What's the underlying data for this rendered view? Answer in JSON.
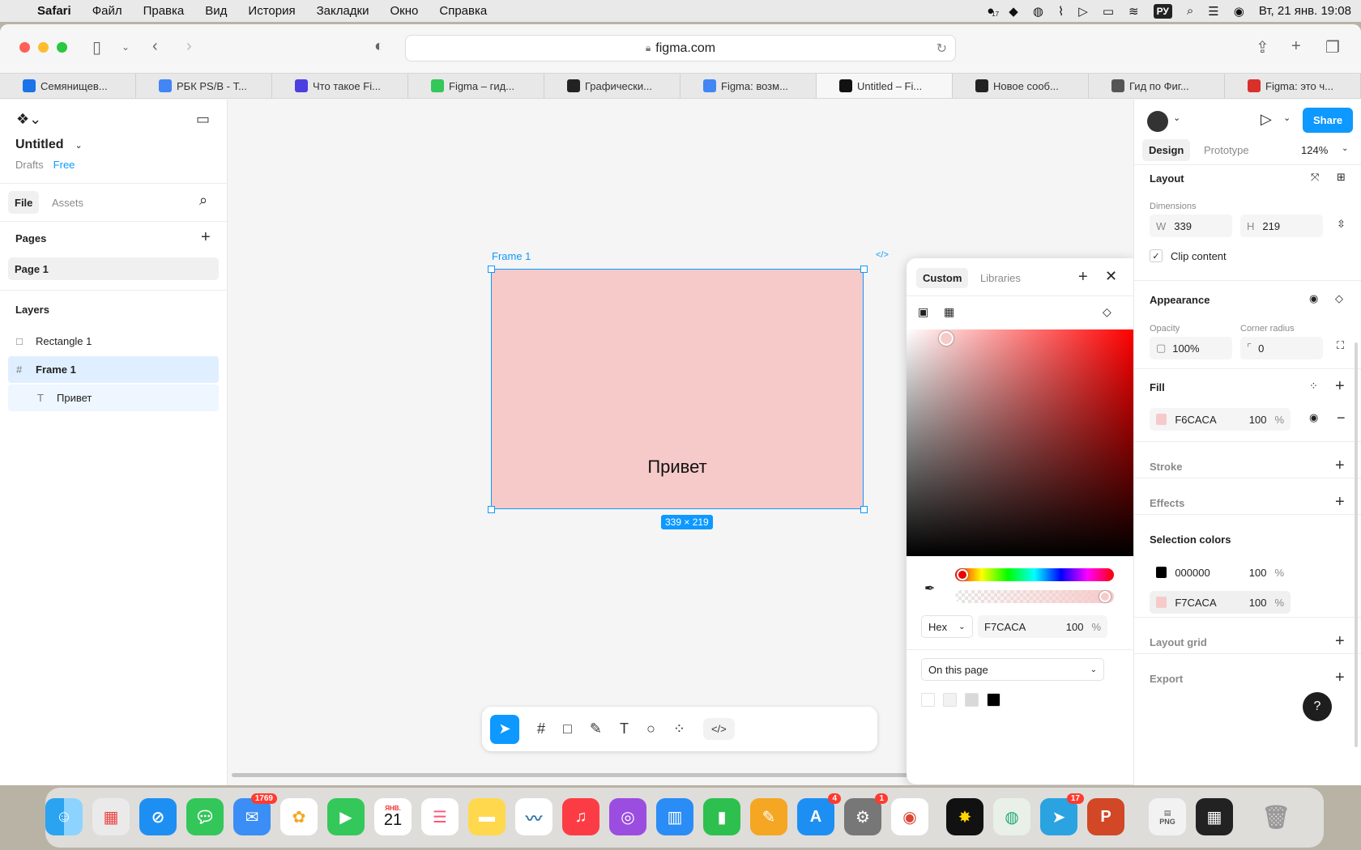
{
  "menubar": {
    "app": "Safari",
    "items": [
      "Файл",
      "Правка",
      "Вид",
      "История",
      "Закладки",
      "Окно",
      "Справка"
    ],
    "input_source": "РУ",
    "clock": "Вт, 21 янв. 19:08",
    "badge_count": "17"
  },
  "browser": {
    "url": "figma.com",
    "tabs": [
      {
        "label": "Семянищев...",
        "color": "#1a73e8",
        "active": false
      },
      {
        "label": "РБК PS/B - Т...",
        "color": "#4285f4",
        "active": false
      },
      {
        "label": "Что такое Fi...",
        "color": "#4b3fe0",
        "active": false
      },
      {
        "label": "Figma – гид...",
        "color": "#34c759",
        "active": false
      },
      {
        "label": "Графически...",
        "color": "#222222",
        "active": false
      },
      {
        "label": "Figma: возм...",
        "color": "#4285f4",
        "active": false
      },
      {
        "label": "Untitled – Fi...",
        "color": "#111111",
        "active": true
      },
      {
        "label": "Новое сооб...",
        "color": "#222222",
        "active": false
      },
      {
        "label": "Гид по Фиг...",
        "color": "#555555",
        "active": false
      },
      {
        "label": "Figma: это ч...",
        "color": "#d9302c",
        "active": false
      }
    ]
  },
  "figma": {
    "file_name": "Untitled",
    "drafts": "Drafts",
    "plan": "Free",
    "tab_file": "File",
    "tab_assets": "Assets",
    "pages_title": "Pages",
    "page1": "Page 1",
    "layers_title": "Layers",
    "layers": [
      {
        "name": "Rectangle 1",
        "icon": "rectangle-icon",
        "indent": 0,
        "selected": false
      },
      {
        "name": "Frame 1",
        "icon": "frame-icon",
        "indent": 0,
        "selected": true
      },
      {
        "name": "Привет",
        "icon": "text-icon",
        "indent": 1,
        "selected": true
      }
    ],
    "frame_label": "Frame 1",
    "frame_text": "Привет",
    "size_badge": "339 × 219",
    "frame_color": "#F7CACA",
    "picker": {
      "tab_custom": "Custom",
      "tab_libraries": "Libraries",
      "format": "Hex",
      "hex": "F7CACA",
      "opacity": "100",
      "percent": "%",
      "scope": "On this page",
      "doc_colors": [
        "#ffffff",
        "#f2f2f2",
        "#d9d9d9",
        "#000000"
      ]
    },
    "right": {
      "tab_design": "Design",
      "tab_prototype": "Prototype",
      "zoom": "124%",
      "share": "Share",
      "layout_title": "Layout",
      "dimensions_label": "Dimensions",
      "w_label": "W",
      "w_value": "339",
      "h_label": "H",
      "h_value": "219",
      "clip_content": "Clip content",
      "appearance_title": "Appearance",
      "opacity_label": "Opacity",
      "opacity_value": "100%",
      "corner_label": "Corner radius",
      "corner_value": "0",
      "fill_title": "Fill",
      "fill_hex": "F6CACA",
      "fill_opacity": "100",
      "percent": "%",
      "stroke_title": "Stroke",
      "effects_title": "Effects",
      "selection_colors_title": "Selection colors",
      "selection_colors": [
        {
          "hex": "000000",
          "opacity": "100",
          "color": "#000000"
        },
        {
          "hex": "F7CACA",
          "opacity": "100",
          "color": "#F7CACA"
        }
      ],
      "layout_grid_title": "Layout grid",
      "export_title": "Export",
      "help": "?"
    }
  },
  "dock": {
    "mail_badge": "1769",
    "calendar_month": "ЯНВ.",
    "calendar_day": "21",
    "appstore_badge": "4",
    "settings_badge": "1",
    "telegram_badge": "17",
    "png_label": "PNG"
  }
}
